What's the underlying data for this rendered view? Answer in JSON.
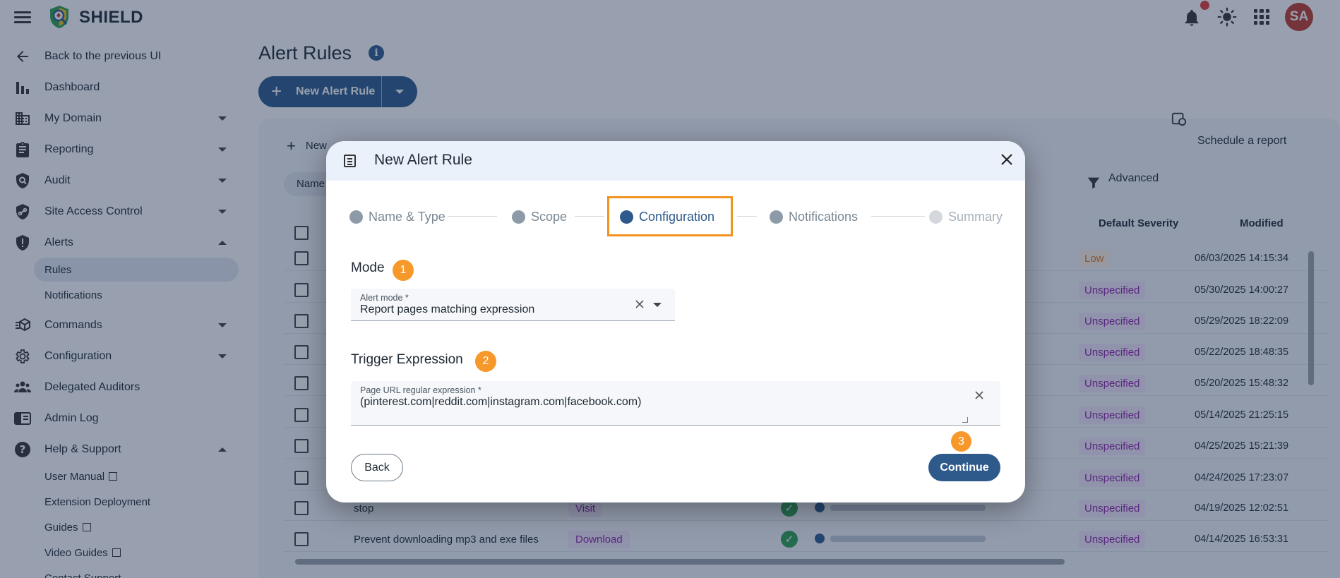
{
  "app": {
    "brand": "SHIELD",
    "avatar_initials": "SA",
    "colors": {
      "primary": "#2d5a8b",
      "accent": "#f7982a",
      "notification": "#e53935",
      "avatar": "#c0392b"
    }
  },
  "sidebar": {
    "back_label": "Back to the previous UI",
    "items": [
      {
        "label": "Dashboard",
        "icon": "bar-chart-icon"
      },
      {
        "label": "My Domain",
        "icon": "building-icon"
      },
      {
        "label": "Reporting",
        "icon": "clipboard-icon"
      },
      {
        "label": "Audit",
        "icon": "shield-search-icon"
      },
      {
        "label": "Site Access Control",
        "icon": "link-shield-icon"
      },
      {
        "label": "Alerts",
        "icon": "shield-alert-icon"
      },
      {
        "label": "Commands",
        "icon": "commands-icon"
      },
      {
        "label": "Configuration",
        "icon": "gear-icon"
      },
      {
        "label": "Delegated Auditors",
        "icon": "people-icon"
      },
      {
        "label": "Admin Log",
        "icon": "log-icon"
      },
      {
        "label": "Help & Support",
        "icon": "help-icon"
      }
    ],
    "alerts_sub": [
      "Rules",
      "Notifications"
    ],
    "help_sub": [
      "User Manual",
      "Extension Deployment",
      "Guides",
      "Video Guides",
      "Contact Support"
    ]
  },
  "main": {
    "title": "Alert Rules",
    "new_button": "New Alert Rule",
    "panel_tab": "New",
    "schedule": "Schedule a report",
    "filter_chip": "Name",
    "advanced": "Advanced",
    "columns": {
      "severity": "Default Severity",
      "modified": "Modified"
    },
    "rows": [
      {
        "name": "",
        "type": "",
        "severity": "Low",
        "modified": "06/03/2025 14:15:34"
      },
      {
        "name": "",
        "type": "",
        "severity": "Unspecified",
        "modified": "05/30/2025 14:00:27"
      },
      {
        "name": "",
        "type": "",
        "severity": "Unspecified",
        "modified": "05/29/2025 18:22:09"
      },
      {
        "name": "",
        "type": "",
        "severity": "Unspecified",
        "modified": "05/22/2025 18:48:35"
      },
      {
        "name": "",
        "type": "",
        "severity": "Unspecified",
        "modified": "05/20/2025 15:48:32"
      },
      {
        "name": "",
        "type": "",
        "severity": "Unspecified",
        "modified": "05/14/2025 21:25:15"
      },
      {
        "name": "",
        "type": "",
        "severity": "Unspecified",
        "modified": "04/25/2025 15:21:39"
      },
      {
        "name": "",
        "type": "",
        "severity": "Unspecified",
        "modified": "04/24/2025 17:23:07"
      },
      {
        "name": "stop",
        "type": "Visit",
        "severity": "Unspecified",
        "modified": "04/19/2025 12:02:51"
      },
      {
        "name": "Prevent downloading mp3 and exe files",
        "type": "Download",
        "severity": "Unspecified",
        "modified": "04/14/2025 16:53:31"
      }
    ]
  },
  "dialog": {
    "title": "New Alert Rule",
    "steps": [
      "Name & Type",
      "Scope",
      "Configuration",
      "Notifications",
      "Summary"
    ],
    "current_step": "Configuration",
    "mode": {
      "label": "Mode",
      "badge": "1",
      "field_label": "Alert mode *",
      "value": "Report pages matching expression"
    },
    "trigger": {
      "label": "Trigger Expression",
      "badge": "2",
      "field_label": "Page URL regular expression *",
      "value": "(pinterest.com|reddit.com|instagram.com|facebook.com)"
    },
    "continue_badge": "3",
    "back_label": "Back",
    "continue_label": "Continue"
  }
}
